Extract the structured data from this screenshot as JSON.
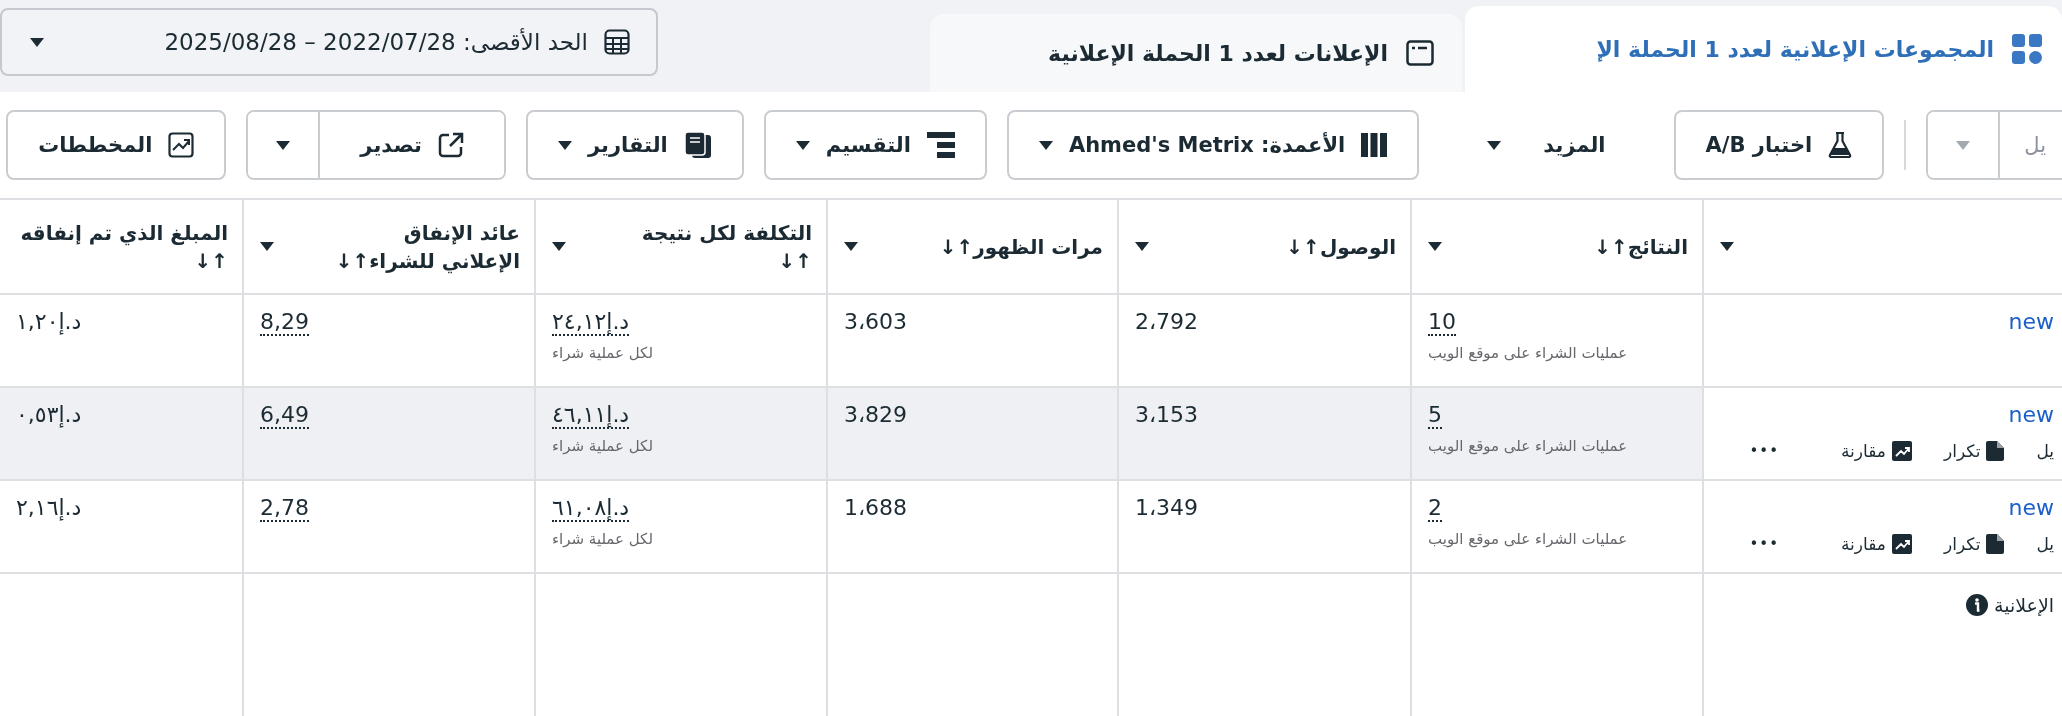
{
  "date_range": {
    "label": "الحد الأقصى: 2022/07/28 – 2025/08/28"
  },
  "tabs": [
    {
      "label": "المجموعات الإعلانية لعدد 1 الحملة الإ",
      "kind": "adsets",
      "selected": true
    },
    {
      "label": "الإعلانات لعدد 1 الحملة الإعلانية",
      "kind": "ads",
      "selected": false
    }
  ],
  "toolbar": [
    {
      "label": "يل",
      "kind": "split",
      "disabled": true
    },
    {
      "kind": "separator"
    },
    {
      "label": "اختبار A/B",
      "kind": "test",
      "disabled": false
    },
    {
      "label": "المزيد",
      "kind": "menu",
      "disabled": false
    },
    {
      "label": "الأعمدة: Ahmed's Metrix",
      "kind": "columns",
      "disabled": false
    },
    {
      "label": "التقسيم",
      "kind": "breakdown",
      "disabled": false
    },
    {
      "label": "التقارير",
      "kind": "reports",
      "disabled": false
    },
    {
      "label": "تصدير",
      "kind": "export",
      "disabled": false
    },
    {
      "label": "المخططات",
      "kind": "charts",
      "disabled": false
    }
  ],
  "table": {
    "columns": [
      {
        "label": "النتائج↑↓"
      },
      {
        "label": "الوصول↑↓"
      },
      {
        "label": "مرات الظهور↑↓"
      },
      {
        "label": "التكلفة لكل نتيجة ↑↓"
      },
      {
        "label": "عائد الإنفاق الإعلاني للشراء↑↓"
      },
      {
        "label": "المبلغ الذي تم إنفاقه ↑↓"
      }
    ],
    "rows": [
      {
        "name": "new",
        "highlighted": false,
        "results": "10",
        "result_type": "عمليات الشراء على موقع الويب",
        "reach": "2،792",
        "impressions": "3،603",
        "cost_per_result": "د.إ٢٤,١٢",
        "cost_unit": "لكل عملية شراء",
        "roas": "8,29",
        "amount_spent": "د.إ١,٢٠"
      },
      {
        "name": "new",
        "highlighted": true,
        "results": "5",
        "result_type": "عمليات الشراء على موقع الويب",
        "reach": "3،153",
        "impressions": "3،829",
        "cost_per_result": "د.إ٤٦,١١",
        "cost_unit": "لكل عملية شراء",
        "roas": "6,49",
        "amount_spent": "د.إ٠,٥٣",
        "actions": [
          {
            "label": "يل",
            "kind": "edit"
          },
          {
            "label": "تكرار",
            "kind": "duplicate"
          },
          {
            "label": "مقارنة",
            "kind": "compare"
          },
          {
            "label": "•••",
            "kind": "more"
          }
        ]
      },
      {
        "name": "new",
        "highlighted": false,
        "results": "2",
        "result_type": "عمليات الشراء على موقع الويب",
        "reach": "1،349",
        "impressions": "1،688",
        "cost_per_result": "د.إ٦١,٠٨",
        "cost_unit": "لكل عملية شراء",
        "roas": "2,78",
        "amount_spent": "د.إ٢,١٦",
        "actions": [
          {
            "label": "يل",
            "kind": "edit"
          },
          {
            "label": "تكرار",
            "kind": "duplicate"
          },
          {
            "label": "مقارنة",
            "kind": "compare"
          },
          {
            "label": "•••",
            "kind": "more"
          }
        ]
      }
    ],
    "footer": {
      "text": "الإعلانية"
    }
  }
}
